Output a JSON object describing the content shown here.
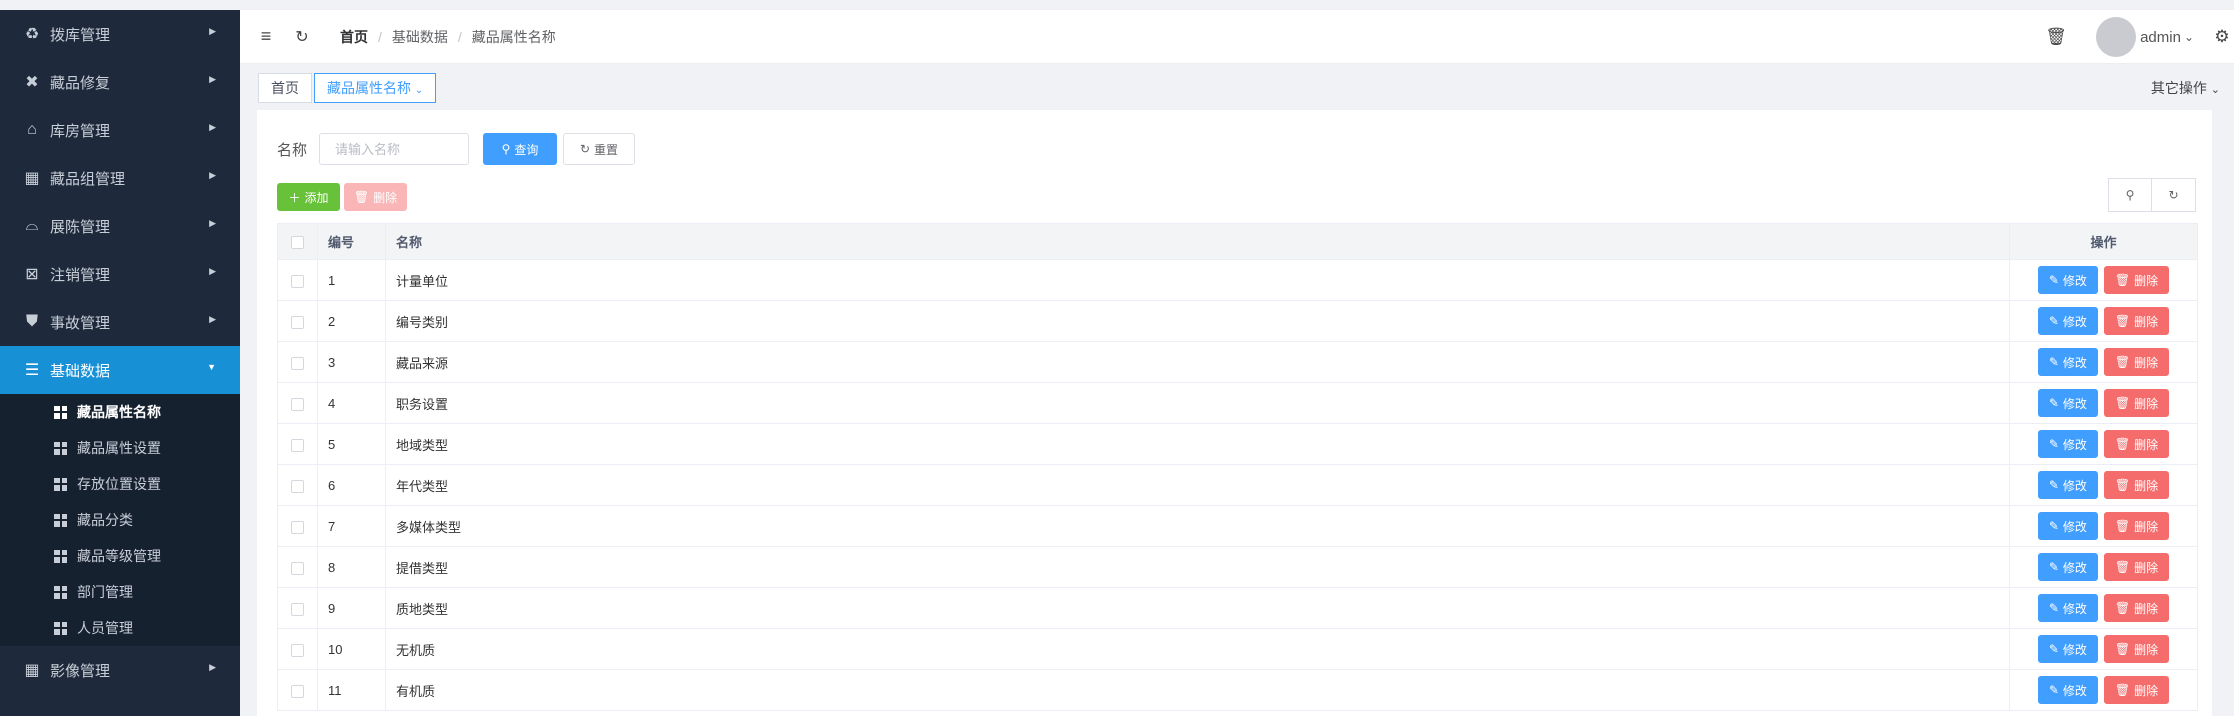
{
  "sidebar": {
    "items": [
      {
        "label": "拨库管理",
        "icon": "recycle-icon"
      },
      {
        "label": "藏品修复",
        "icon": "tools-icon"
      },
      {
        "label": "库房管理",
        "icon": "home-icon"
      },
      {
        "label": "藏品组管理",
        "icon": "grid-icon"
      },
      {
        "label": "展陈管理",
        "icon": "museum-icon"
      },
      {
        "label": "注销管理",
        "icon": "close-box-icon"
      },
      {
        "label": "事故管理",
        "icon": "shirt-icon"
      },
      {
        "label": "基础数据",
        "icon": "list-icon"
      }
    ],
    "subitems": [
      "藏品属性名称",
      "藏品属性设置",
      "存放位置设置",
      "藏品分类",
      "藏品等级管理",
      "部门管理",
      "人员管理"
    ],
    "last_item": {
      "label": "影像管理",
      "icon": "grid-icon"
    }
  },
  "header": {
    "breadcrumb": [
      "首页",
      "基础数据",
      "藏品属性名称"
    ],
    "username": "admin"
  },
  "tags": {
    "home": "首页",
    "current": "藏品属性名称",
    "other_ops": "其它操作"
  },
  "search": {
    "label": "名称",
    "placeholder": "请输入名称",
    "query_label": "查询",
    "reset_label": "重置"
  },
  "toolbar": {
    "add_label": "添加",
    "delete_label": "删除"
  },
  "table": {
    "headers": {
      "no": "编号",
      "name": "名称",
      "op": "操作"
    },
    "edit_label": "修改",
    "delete_label": "删除",
    "rows": [
      {
        "no": "1",
        "name": "计量单位"
      },
      {
        "no": "2",
        "name": "编号类别"
      },
      {
        "no": "3",
        "name": "藏品来源"
      },
      {
        "no": "4",
        "name": "职务设置"
      },
      {
        "no": "5",
        "name": "地域类型"
      },
      {
        "no": "6",
        "name": "年代类型"
      },
      {
        "no": "7",
        "name": "多媒体类型"
      },
      {
        "no": "8",
        "name": "提借类型"
      },
      {
        "no": "9",
        "name": "质地类型"
      },
      {
        "no": "10",
        "name": "无机质"
      },
      {
        "no": "11",
        "name": "有机质"
      }
    ]
  },
  "colors": {
    "sidebar_bg": "#1e2a3b",
    "active": "#1890d6",
    "primary": "#409eff",
    "success": "#67c23a",
    "danger": "#f56c6c"
  }
}
